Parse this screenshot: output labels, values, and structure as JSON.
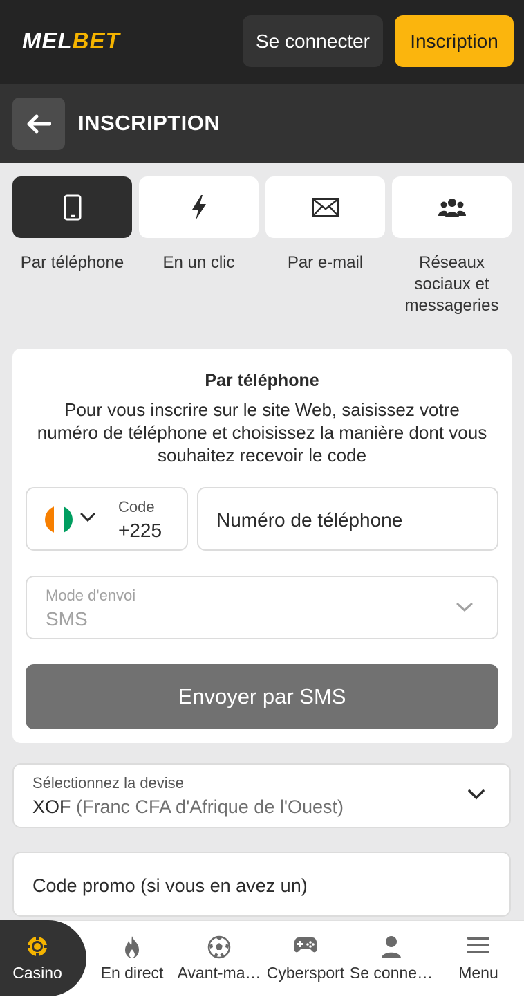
{
  "header": {
    "logo_part1": "MEL",
    "logo_part2": "BET",
    "login_label": "Se connecter",
    "register_label": "Inscription"
  },
  "section": {
    "title": "INSCRIPTION"
  },
  "methods": [
    {
      "label": "Par téléphone",
      "icon": "smartphone-icon",
      "active": true
    },
    {
      "label": "En un clic",
      "icon": "lightning-icon",
      "active": false
    },
    {
      "label": "Par e-mail",
      "icon": "envelope-icon",
      "active": false
    },
    {
      "label": "Réseaux sociaux et messageries",
      "icon": "users-icon",
      "active": false
    }
  ],
  "form": {
    "title": "Par téléphone",
    "description": "Pour vous inscrire sur le site Web, saisissez votre numéro de téléphone et choisissez la manière dont vous souhaitez recevoir le code",
    "code_label": "Code",
    "code_value": "+225",
    "phone_placeholder": "Numéro de téléphone",
    "mode_label": "Mode d'envoi",
    "mode_value": "SMS",
    "send_button": "Envoyer par SMS"
  },
  "currency": {
    "label": "Sélectionnez la devise",
    "code": "XOF",
    "name": "(Franc CFA d'Afrique de l'Ouest)"
  },
  "promo": {
    "placeholder": "Code promo (si vous en avez un)"
  },
  "bottom_nav": [
    {
      "label": "Casino",
      "icon": "casino-chip-icon",
      "active": true
    },
    {
      "label": "En direct",
      "icon": "flame-icon"
    },
    {
      "label": "Avant-ma…",
      "icon": "soccer-ball-icon"
    },
    {
      "label": "Cybersport",
      "icon": "gamepad-icon"
    },
    {
      "label": "Se conne…",
      "icon": "user-icon"
    },
    {
      "label": "Menu",
      "icon": "hamburger-menu-icon"
    }
  ],
  "colors": {
    "accent": "#fbb50d",
    "header_bg": "#242424",
    "active_tab_bg": "#2e2e2e",
    "button_disabled": "#717171"
  }
}
